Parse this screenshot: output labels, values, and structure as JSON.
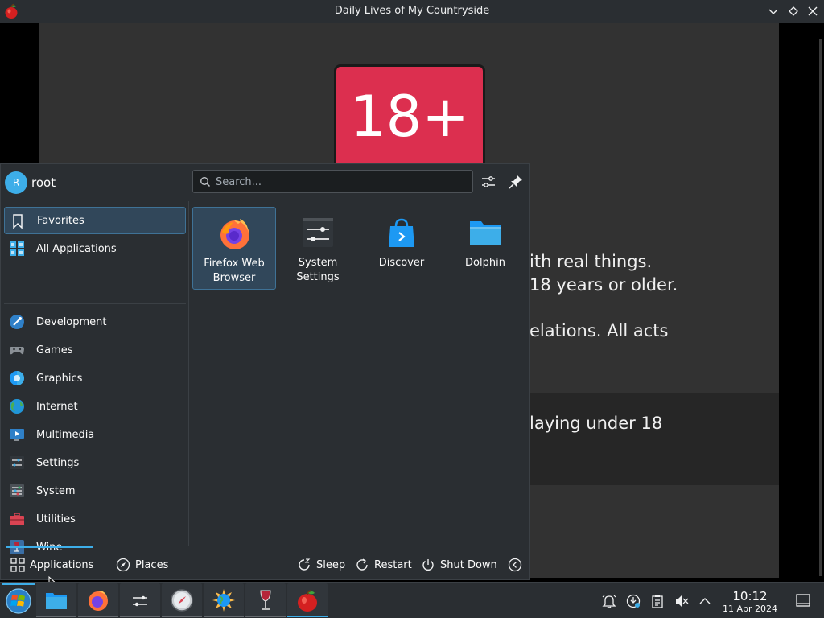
{
  "window": {
    "title": "Daily Lives of My Countryside",
    "app_icon": "apple-icon"
  },
  "game": {
    "badge": "18+",
    "lines": [
      "ith real things.",
      "18 years or older.",
      "elations. All acts",
      "laying under 18"
    ]
  },
  "launcher": {
    "user": {
      "initial": "R",
      "name": "root"
    },
    "search": {
      "placeholder": "Search..."
    },
    "categories": [
      {
        "label": "Favorites",
        "icon": "bookmark-icon"
      },
      {
        "label": "All Applications",
        "icon": "grid-icon"
      },
      {
        "label": "Development",
        "icon": "development-icon"
      },
      {
        "label": "Games",
        "icon": "gamepad-icon"
      },
      {
        "label": "Graphics",
        "icon": "graphics-icon"
      },
      {
        "label": "Internet",
        "icon": "globe-icon"
      },
      {
        "label": "Multimedia",
        "icon": "multimedia-icon"
      },
      {
        "label": "Settings",
        "icon": "settings-icon"
      },
      {
        "label": "System",
        "icon": "system-icon"
      },
      {
        "label": "Utilities",
        "icon": "toolbox-icon"
      },
      {
        "label": "Wine",
        "icon": "wine-icon"
      }
    ],
    "favorites": [
      {
        "label": "Firefox Web Browser",
        "icon": "firefox-icon"
      },
      {
        "label": "System Settings",
        "icon": "system-settings-icon"
      },
      {
        "label": "Discover",
        "icon": "discover-icon"
      },
      {
        "label": "Dolphin",
        "icon": "folder-icon"
      }
    ],
    "footer": {
      "applications": "Applications",
      "places": "Places",
      "sleep": "Sleep",
      "restart": "Restart",
      "shutdown": "Shut Down"
    }
  },
  "panel": {
    "clock": {
      "time": "10:12",
      "date": "11 Apr 2024"
    }
  }
}
